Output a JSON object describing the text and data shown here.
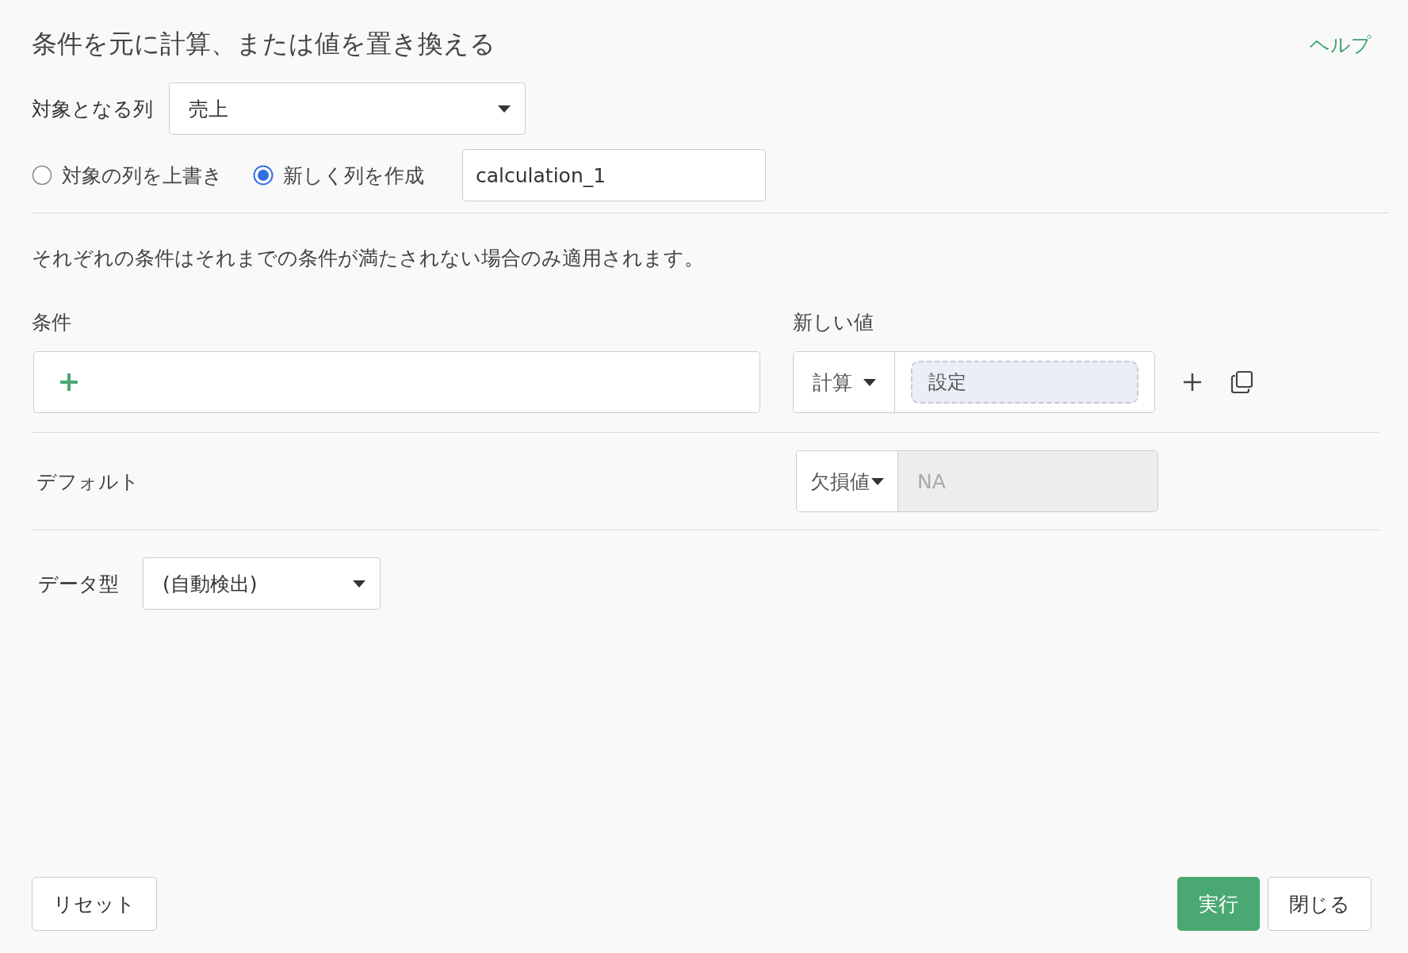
{
  "title": "条件を元に計算、または値を置き換える",
  "help_link": "ヘルプ",
  "target_column": {
    "label": "対象となる列",
    "value": "売上"
  },
  "output_mode": {
    "options": [
      {
        "label": "対象の列を上書き",
        "selected": false
      },
      {
        "label": "新しく列を作成",
        "selected": true
      }
    ],
    "new_column_name": "calculation_1"
  },
  "note": "それぞれの条件はそれまでの条件が満たされない場合のみ適用されます。",
  "conditions": {
    "condition_heading": "条件",
    "value_heading": "新しい値",
    "rows": [
      {
        "value_type": "計算",
        "value_placeholder": "設定"
      }
    ]
  },
  "default": {
    "label": "デフォルト",
    "value_type": "欠損値",
    "value": "NA"
  },
  "data_type": {
    "label": "データ型",
    "value": "(自動検出)"
  },
  "buttons": [
    {
      "label": "リセット",
      "kind": "secondary"
    },
    {
      "label": "実行",
      "kind": "primary"
    },
    {
      "label": "閉じる",
      "kind": "secondary"
    }
  ]
}
